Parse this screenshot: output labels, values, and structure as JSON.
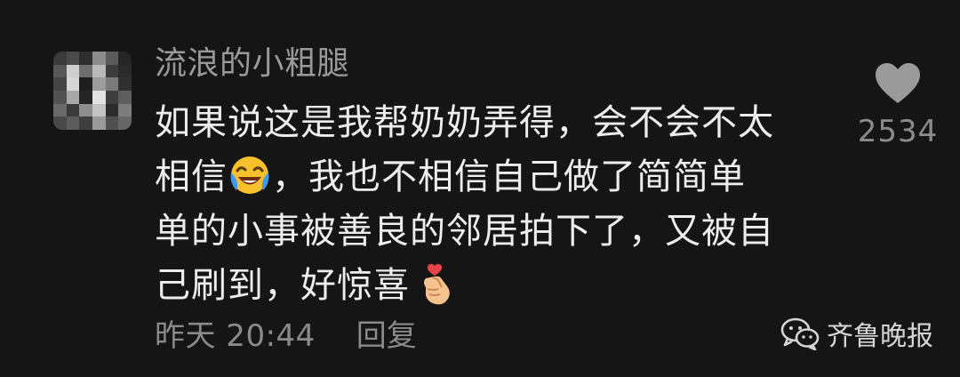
{
  "comment": {
    "username": "流浪的小粗腿",
    "lines": [
      {
        "text": "如果说这是我帮奶奶弄得，会不会不太",
        "emoji": null,
        "after": ""
      },
      {
        "text": "相信",
        "emoji": "laughing-crying-emoji",
        "after": "，我也不相信自己做了简简单"
      },
      {
        "text": "单的小事被善良的邻居拍下了，又被自",
        "emoji": null,
        "after": ""
      },
      {
        "text": "己刷到，好惊喜",
        "emoji": "finger-heart-emoji",
        "after": ""
      }
    ],
    "timestamp": "昨天 20:44",
    "reply_label": "回复",
    "like_count": "2534",
    "like_icon": "heart-icon"
  },
  "watermark": {
    "icon": "wechat-icon",
    "text": "齐鲁晚报"
  },
  "colors": {
    "background": "#151515",
    "text_primary": "#ededed",
    "text_secondary": "#8a8a8a",
    "heart": "#9a9a9a"
  }
}
